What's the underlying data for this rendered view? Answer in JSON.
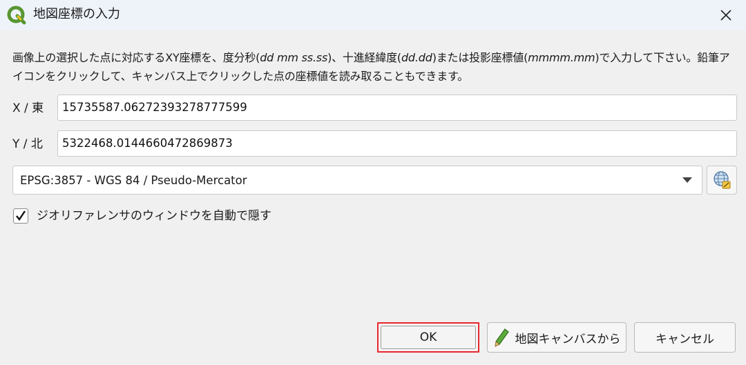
{
  "window": {
    "title": "地図座標の入力",
    "app_icon": "qgis-logo-icon",
    "close_icon": "close-icon"
  },
  "description": {
    "part1": "画像上の選択した点に対応するXY座標を、度分秒(",
    "em1": "dd mm ss.ss",
    "part2": ")、十進経緯度(",
    "em2": "dd.dd",
    "part3": ")または投影座標値(",
    "em3": "mmmm.mm",
    "part4": ")で入力して下さい。鉛筆アイコンをクリックして、キャンバス上でクリックした点の座標値を読み取ることもできます。"
  },
  "x_field": {
    "label": "X / 東",
    "value": "15735587.06272393278777599"
  },
  "y_field": {
    "label": "Y / 北",
    "value": "5322468.0144660472869873"
  },
  "crs": {
    "selected": "EPSG:3857 - WGS 84 / Pseudo-Mercator",
    "button_icon": "crs-globe-icon"
  },
  "auto_hide": {
    "label": "ジオリファレンサのウィンドウを自動で隠す",
    "checked": true
  },
  "buttons": {
    "ok": "OK",
    "from_canvas": "地図キャンバスから",
    "from_canvas_icon": "pencil-icon",
    "cancel": "キャンセル"
  },
  "colors": {
    "titlebar": "#eef3fa",
    "background": "#f0f0f0",
    "ok_highlight": "#e8252b",
    "qgis_green": "#589632",
    "qgis_yellow": "#ee7913"
  }
}
